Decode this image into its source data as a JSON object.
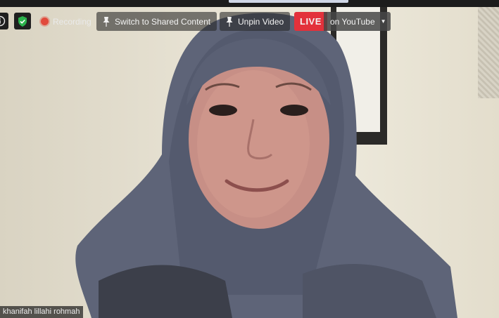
{
  "toolbar": {
    "recording_label": "Recording",
    "switch_label": "Switch to Shared Content",
    "unpin_label": "Unpin Video",
    "live_label": "LIVE",
    "youtube_label": "on YouTube",
    "icons": [
      "info-icon",
      "shield-icon",
      "record-dot-icon",
      "pin-icon",
      "chevron-down-icon"
    ]
  },
  "participant": {
    "name": "khanifah lillahi rohmah"
  },
  "colors": {
    "live": "#e3313b",
    "shield": "#2bb24c",
    "record_dot": "#e14a3c"
  }
}
